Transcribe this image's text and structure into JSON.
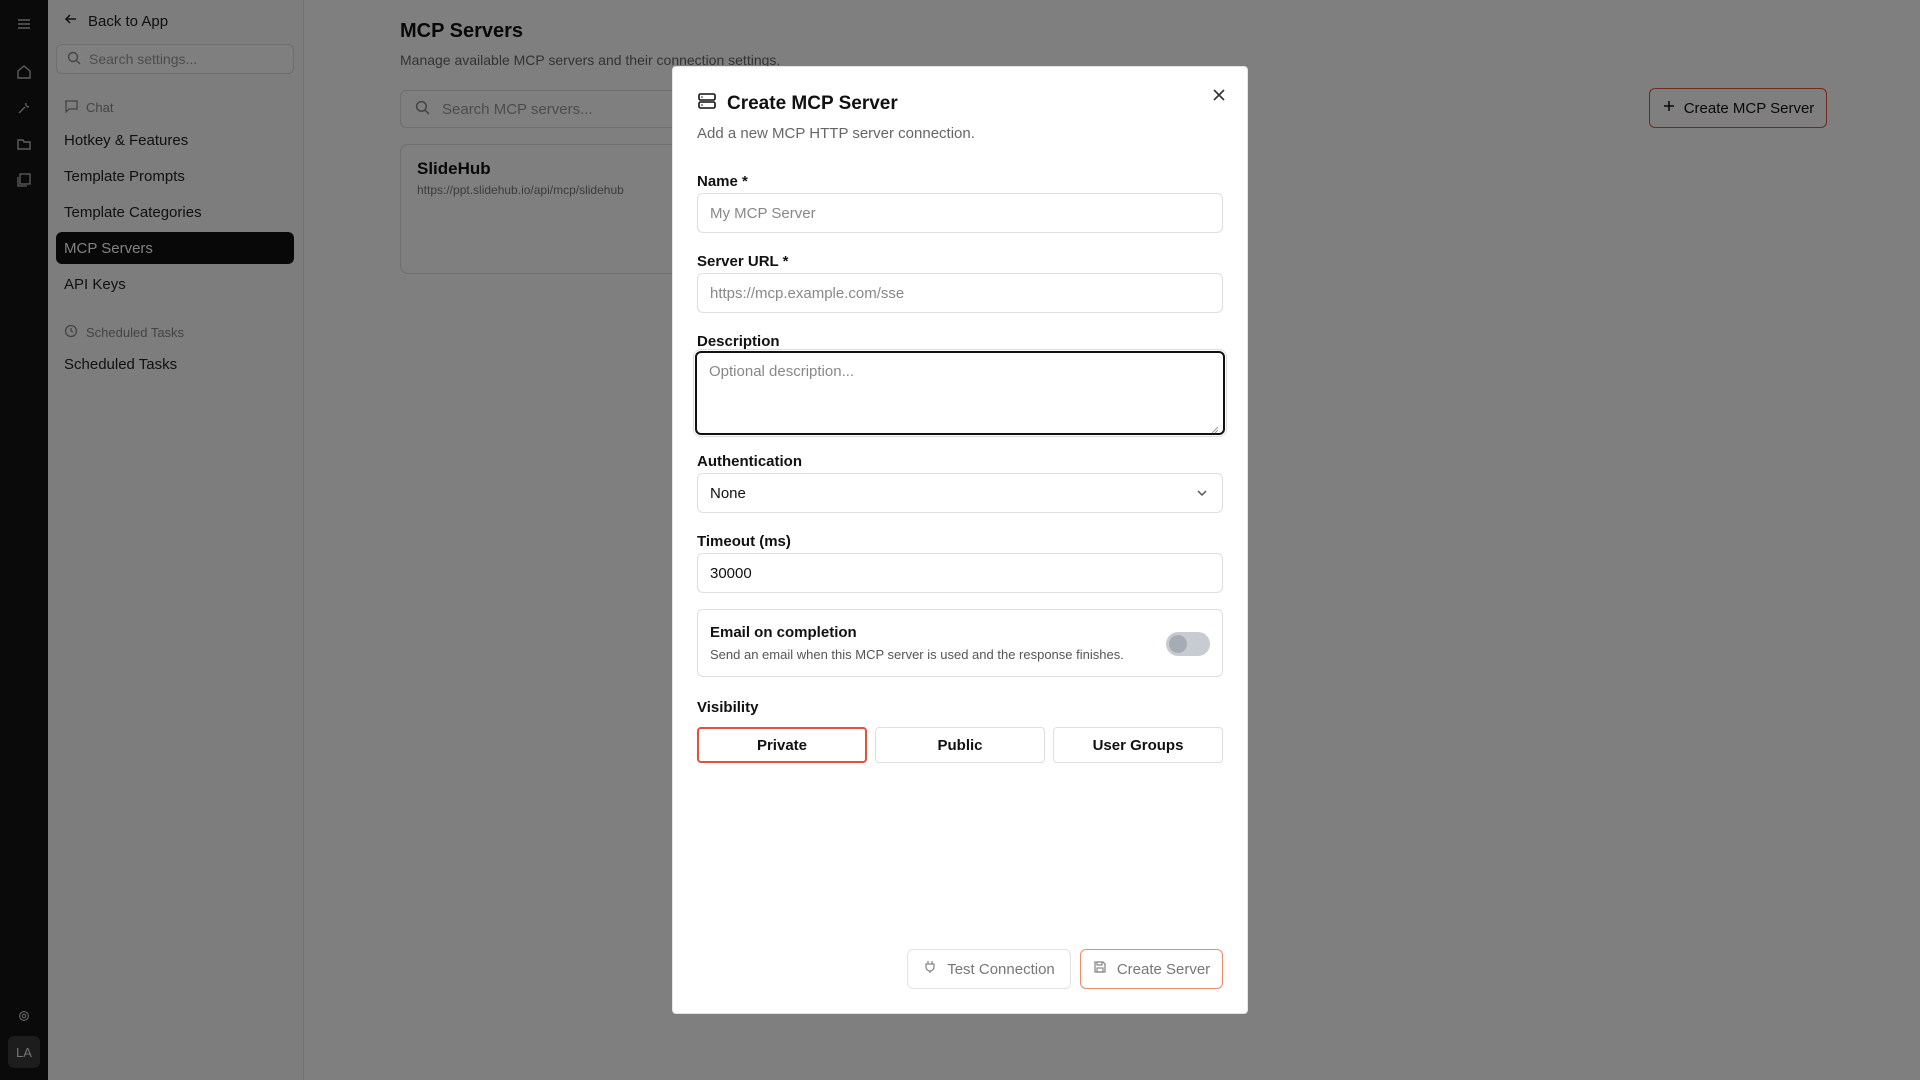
{
  "sidebar": {
    "back_label": "Back to App",
    "search_placeholder": "Search settings...",
    "chat_section": "Chat",
    "items": [
      {
        "label": "Hotkey & Features"
      },
      {
        "label": "Template Prompts"
      },
      {
        "label": "Template Categories"
      },
      {
        "label": "MCP Servers",
        "active": true
      },
      {
        "label": "API Keys"
      }
    ],
    "scheduled_section": "Scheduled Tasks",
    "scheduled_item": "Scheduled Tasks"
  },
  "rail": {
    "icons": [
      "menu-icon",
      "home-icon",
      "wrench-icon",
      "folder-icon",
      "gallery-icon",
      "settings-icon"
    ],
    "avatar_initials": "LA"
  },
  "main": {
    "title": "MCP Servers",
    "subtitle": "Manage available MCP servers and their connection settings.",
    "search_placeholder": "Search MCP servers...",
    "create_button": "Create MCP Server",
    "servers": [
      {
        "name": "SlideHub",
        "url": "https://ppt.slidehub.io/api/mcp/slidehub"
      }
    ]
  },
  "modal": {
    "title": "Create MCP Server",
    "description": "Add a new MCP HTTP server connection.",
    "name_label": "Name *",
    "name_placeholder": "My MCP Server",
    "url_label": "Server URL *",
    "url_placeholder": "https://mcp.example.com/sse",
    "description_label": "Description",
    "description_placeholder": "Optional description...",
    "auth_label": "Authentication",
    "auth_value": "None",
    "timeout_label": "Timeout (ms)",
    "timeout_value": "30000",
    "email_title": "Email on completion",
    "email_desc": "Send an email when this MCP server is used and the response finishes.",
    "email_enabled": false,
    "visibility_label": "Visibility",
    "visibility_options": [
      "Private",
      "Public",
      "User Groups"
    ],
    "visibility_selected": "Private",
    "test_button": "Test Connection",
    "create_button": "Create Server"
  },
  "colors": {
    "accent": "#e0523a",
    "rail_bg": "#141414",
    "overlay": "rgba(0,0,0,0.5)"
  }
}
